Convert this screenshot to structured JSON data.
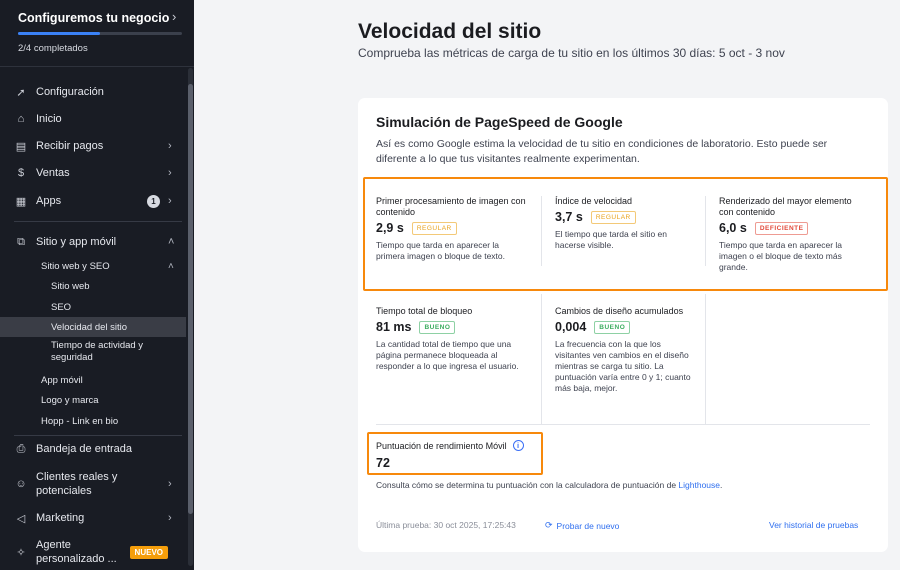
{
  "setup": {
    "title": "Configuremos tu negocio",
    "count": "2/4 completados",
    "progress": 0.5
  },
  "nav": {
    "configuracion": "Configuración",
    "inicio": "Inicio",
    "recibir_pagos": "Recibir pagos",
    "ventas": "Ventas",
    "apps": "Apps",
    "apps_badge": "1",
    "sitio_app": "Sitio y app móvil",
    "sitio_web_seo": "Sitio web y SEO",
    "sitio_web": "Sitio web",
    "seo": "SEO",
    "velocidad": "Velocidad del sitio",
    "tiempo_actividad": "Tiempo de actividad y seguridad",
    "app_movil": "App móvil",
    "logo_marca": "Logo y marca",
    "hopp": "Hopp - Link en bio",
    "bandeja": "Bandeja de entrada",
    "clientes": "Clientes reales y potenciales",
    "marketing": "Marketing",
    "agente": "Agente personalizado ...",
    "nuevo_badge": "NUEVO"
  },
  "page": {
    "title": "Velocidad del sitio",
    "subtitle": "Comprueba las métricas de carga de tu sitio en los últimos 30 días: 5 oct - 3 nov"
  },
  "card": {
    "title": "Simulación de PageSpeed de Google",
    "description": "Así es como Google estima la velocidad de tu sitio en condiciones de laboratorio. Esto puede ser diferente a lo que tus visitantes realmente experimentan."
  },
  "metrics": [
    {
      "name": "Primer procesamiento de imagen con contenido",
      "value": "2,9 s",
      "status": "REGULAR",
      "desc": "Tiempo que tarda en aparecer la primera imagen o bloque de texto."
    },
    {
      "name": "Índice de velocidad",
      "value": "3,7 s",
      "status": "REGULAR",
      "desc": "El tiempo que tarda el sitio en hacerse visible."
    },
    {
      "name": "Renderizado del mayor elemento con contenido",
      "value": "6,0 s",
      "status": "DEFICIENTE",
      "desc": "Tiempo que tarda en aparecer la imagen o el bloque de texto más grande."
    },
    {
      "name": "Tiempo total de bloqueo",
      "value": "81 ms",
      "status": "BUENO",
      "desc": "La cantidad total de tiempo que una página permanece bloqueada al responder a lo que ingresa el usuario."
    },
    {
      "name": "Cambios de diseño acumulados",
      "value": "0,004",
      "status": "BUENO",
      "desc": "La frecuencia con la que los visitantes ven cambios en el diseño mientras se carga tu sitio. La puntuación varía entre 0 y 1; cuanto más baja, mejor."
    }
  ],
  "score": {
    "label": "Puntuación de rendimiento Móvil",
    "value": "72",
    "lighthouse_text": "Consulta cómo se determina tu puntuación con la calculadora de puntuación de ",
    "lighthouse_link": "Lighthouse",
    "lighthouse_end": "."
  },
  "footer": {
    "last_test": "Última prueba: 30 oct 2025, 17:25:43",
    "retry": "Probar de nuevo",
    "history": "Ver historial de pruebas"
  },
  "colors": {
    "highlight": "#f7890c",
    "accent": "#3b82f6",
    "link": "#2f6fef"
  }
}
